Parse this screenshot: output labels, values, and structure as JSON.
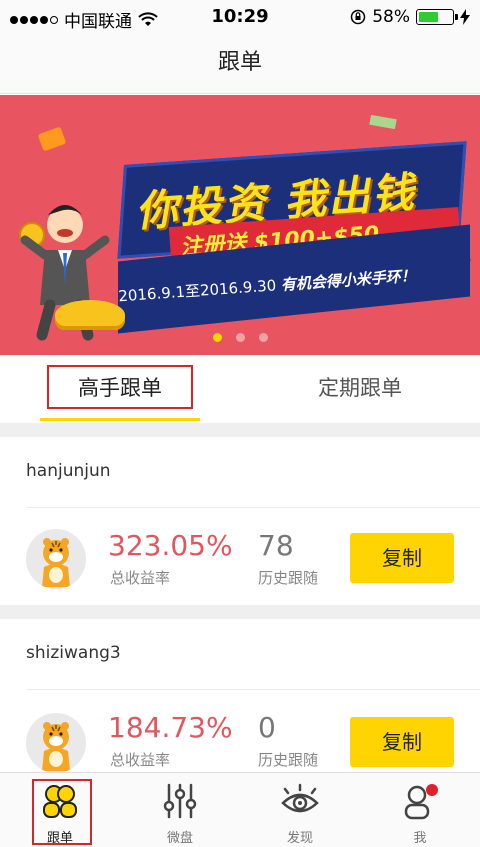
{
  "status_bar": {
    "carrier": "中国联通",
    "time": "10:29",
    "battery_percent": "58%",
    "battery_level": 0.58
  },
  "nav": {
    "title": "跟单"
  },
  "banner": {
    "headline": "你投资 我出钱",
    "promo": "注册送 $100+$50",
    "dates": "2016.9.1至2016.9.30",
    "prize": "有机会得小米手环！",
    "page_count": 3,
    "active_page": 1
  },
  "tabs": [
    {
      "label": "高手跟单",
      "active": true
    },
    {
      "label": "定期跟单",
      "active": false
    }
  ],
  "traders": [
    {
      "username": "hanjunjun",
      "return_rate": "323.05%",
      "return_label": "总收益率",
      "followers": "78",
      "followers_label": "历史跟随",
      "copy_label": "复制"
    },
    {
      "username": "shiziwang3",
      "return_rate": "184.73%",
      "return_label": "总收益率",
      "followers": "0",
      "followers_label": "历史跟随",
      "copy_label": "复制"
    }
  ],
  "tab_bar": [
    {
      "label": "跟单",
      "icon": "users-icon",
      "active": true
    },
    {
      "label": "微盘",
      "icon": "sliders-icon",
      "active": false
    },
    {
      "label": "发现",
      "icon": "eye-icon",
      "active": false
    },
    {
      "label": "我",
      "icon": "profile-icon",
      "active": false,
      "badge": true
    }
  ],
  "colors": {
    "accent": "#ffd400",
    "rate": "#e2565d",
    "highlight_box": "#d6262c",
    "banner_bg": "#e85560"
  }
}
